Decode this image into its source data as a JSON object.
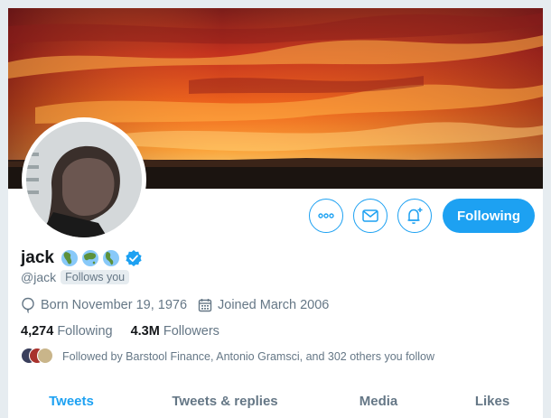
{
  "profile": {
    "name": "jack",
    "handle": "@jack",
    "follows_you": "Follows you",
    "emoji_icons": [
      "globe-africa-icon",
      "globe-asia-icon",
      "globe-americas-icon"
    ],
    "verified_icon": "verified-badge-icon",
    "born": "Born November 19, 1976",
    "joined": "Joined March 2006",
    "following_count": "4,274",
    "following_label": "Following",
    "followers_count": "4.3M",
    "followers_label": "Followers",
    "followed_by": "Followed by Barstool Finance, Antonio Gramsci, and 302 others you follow"
  },
  "actions": {
    "more_icon": "more-icon",
    "message_icon": "envelope-icon",
    "notify_icon": "bell-plus-icon",
    "follow_label": "Following"
  },
  "tabs": [
    {
      "label": "Tweets",
      "active": true
    },
    {
      "label": "Tweets & replies",
      "active": false
    },
    {
      "label": "Media",
      "active": false
    },
    {
      "label": "Likes",
      "active": false
    }
  ],
  "colors": {
    "accent": "#1da1f2",
    "muted": "#657786",
    "text": "#14171a"
  }
}
